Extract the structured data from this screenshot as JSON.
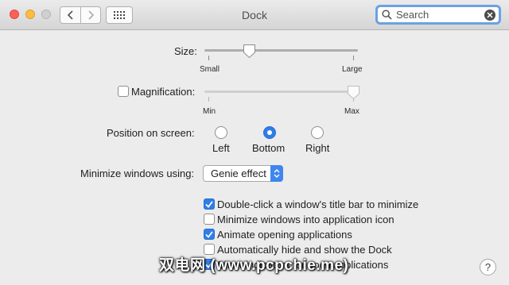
{
  "window": {
    "title": "Dock",
    "traffic_lights": [
      "close",
      "minimize",
      "zoom"
    ],
    "nav": {
      "back_icon": "chevron-left-icon",
      "forward_icon": "chevron-right-icon",
      "grid_icon": "show-all-grid-icon"
    }
  },
  "search": {
    "placeholder": "Search",
    "value": ""
  },
  "size": {
    "label": "Size:",
    "min_label": "Small",
    "max_label": "Large",
    "value": 0.28
  },
  "magnification": {
    "label": "Magnification:",
    "checked": false,
    "min_label": "Min",
    "max_label": "Max",
    "value": 1.0
  },
  "position": {
    "label": "Position on screen:",
    "options": [
      {
        "label": "Left",
        "selected": false
      },
      {
        "label": "Bottom",
        "selected": true
      },
      {
        "label": "Right",
        "selected": false
      }
    ]
  },
  "minimize": {
    "label": "Minimize windows using:",
    "selected": "Genie effect"
  },
  "checkboxes": [
    {
      "label": "Double-click a window's title bar to minimize",
      "checked": true
    },
    {
      "label": "Minimize windows into application icon",
      "checked": false
    },
    {
      "label": "Animate opening applications",
      "checked": true
    },
    {
      "label": "Automatically hide and show the Dock",
      "checked": false
    },
    {
      "label": "Show indicators for open applications",
      "checked": true
    }
  ],
  "help": {
    "label": "?"
  },
  "watermark": {
    "text": "双电网 (www.pcpchie.me)"
  },
  "colors": {
    "accent": "#2f7de8",
    "search_focus": "#6ba1e3"
  }
}
